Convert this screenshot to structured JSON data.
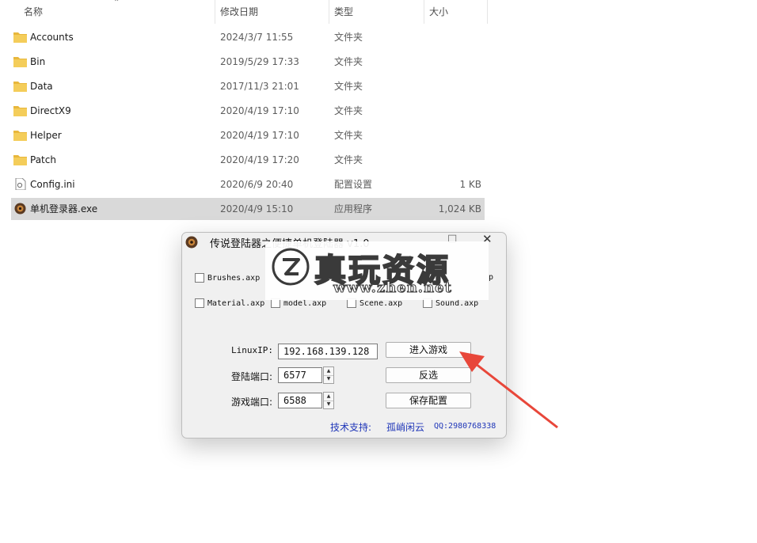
{
  "columns": {
    "name": "名称",
    "modified": "修改日期",
    "type": "类型",
    "size": "大小"
  },
  "files": [
    {
      "name": "Accounts",
      "date": "2024/3/7 11:55",
      "type": "文件夹",
      "size": "",
      "icon": "folder-icon"
    },
    {
      "name": "Bin",
      "date": "2019/5/29 17:33",
      "type": "文件夹",
      "size": "",
      "icon": "folder-icon"
    },
    {
      "name": "Data",
      "date": "2017/11/3 21:01",
      "type": "文件夹",
      "size": "",
      "icon": "folder-icon"
    },
    {
      "name": "DirectX9",
      "date": "2020/4/19 17:10",
      "type": "文件夹",
      "size": "",
      "icon": "folder-icon"
    },
    {
      "name": "Helper",
      "date": "2020/4/19 17:10",
      "type": "文件夹",
      "size": "",
      "icon": "folder-icon"
    },
    {
      "name": "Patch",
      "date": "2020/4/19 17:20",
      "type": "文件夹",
      "size": "",
      "icon": "folder-icon"
    },
    {
      "name": "Config.ini",
      "date": "2020/6/9 20:40",
      "type": "配置设置",
      "size": "1 KB",
      "icon": "ini-file-icon"
    },
    {
      "name": "单机登录器.exe",
      "date": "2020/4/9 15:10",
      "type": "应用程序",
      "size": "1,024 KB",
      "icon": "app-exe-icon",
      "selected": true
    }
  ],
  "dialog": {
    "title": "传说登陆器之便捷单机登陆器 v1.0",
    "minimize_glyph": "□",
    "close_glyph": "✕",
    "checkboxes": [
      {
        "label": "Brushes.axp",
        "checked": false
      },
      {
        "label": "p",
        "checked": false
      },
      {
        "label": "Material.axp",
        "checked": false
      },
      {
        "label": "model.axp",
        "checked": false
      },
      {
        "label": "Scene.axp",
        "checked": false
      },
      {
        "label": "Sound.axp",
        "checked": false
      }
    ],
    "linux_ip_label": "LinuxIP:",
    "linux_ip_value": "192.168.139.128",
    "login_port_label": "登陆端口:",
    "login_port_value": "6577",
    "game_port_label": "游戏端口:",
    "game_port_value": "6588",
    "enter_game_button": "进入游戏",
    "invert_select_button": "反选",
    "save_config_button": "保存配置",
    "support_label": "技术支持:",
    "support_name": "孤峭闲云",
    "support_qq": "QQ:2980768338"
  },
  "watermark": {
    "chinese": "真玩资源",
    "url": "www.zhen.net"
  },
  "colors": {
    "folder": "#f2c94c",
    "selected_row": "#d9d9d9",
    "footer_text": "#1f36b8",
    "arrow": "#e8473a"
  }
}
